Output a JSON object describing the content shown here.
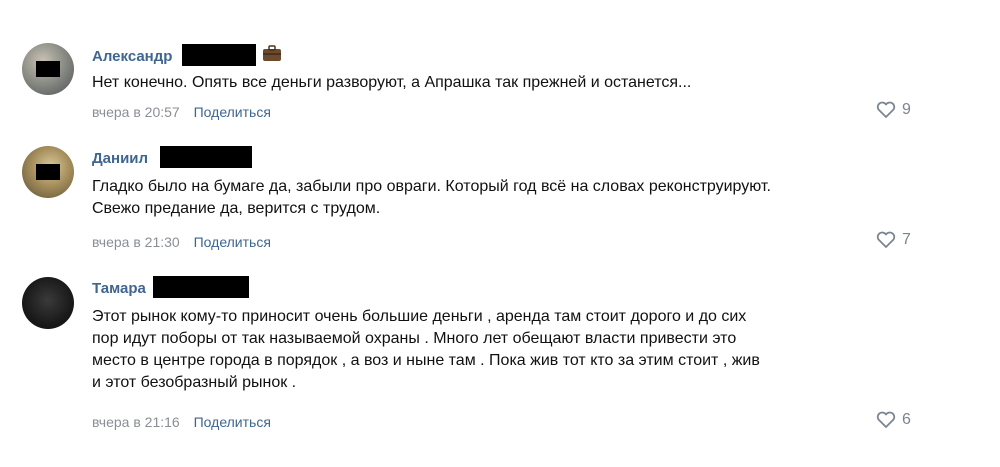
{
  "comments": [
    {
      "author": "Александр",
      "badge_icon": "briefcase-icon",
      "lines": [
        "Нет конечно. Опять все деньги разворуют, а Апрашка так прежней и останется..."
      ],
      "time": "вчера в 20:57",
      "share_label": "Поделиться",
      "like_icon": "heart-icon",
      "likes": "9"
    },
    {
      "author": "Даниил",
      "lines": [
        "Гладко было на бумаге да, забыли про овраги. Который год всё на словах реконструируют.",
        "Свежо предание да, верится с трудом."
      ],
      "time": "вчера в 21:30",
      "share_label": "Поделиться",
      "like_icon": "heart-icon",
      "likes": "7"
    },
    {
      "author": "Тамара",
      "lines": [
        "Этот рынок кому-то приносит очень большие деньги , аренда там стоит дорого и до сих",
        "пор идут поборы от так называемой охраны . Много лет обещают власти привести это",
        "место в центре города в порядок , а воз и ныне там . Пока жив тот кто за этим стоит , жив",
        "и этот безобразный рынок ."
      ],
      "time": "вчера в 21:16",
      "share_label": "Поделиться",
      "like_icon": "heart-icon",
      "likes": "6"
    }
  ],
  "colors": {
    "author": "#3f6690",
    "meta": "#8a8f96",
    "likes": "#7b8591",
    "redaction": "#000000"
  }
}
